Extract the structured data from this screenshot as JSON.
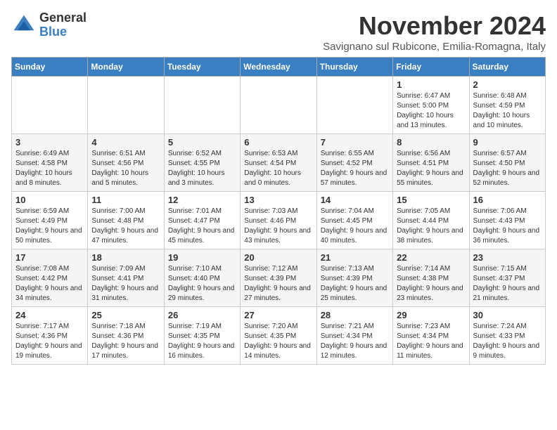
{
  "logo": {
    "general": "General",
    "blue": "Blue"
  },
  "header": {
    "month": "November 2024",
    "location": "Savignano sul Rubicone, Emilia-Romagna, Italy"
  },
  "weekdays": [
    "Sunday",
    "Monday",
    "Tuesday",
    "Wednesday",
    "Thursday",
    "Friday",
    "Saturday"
  ],
  "weeks": [
    [
      {
        "day": "",
        "sunrise": "",
        "sunset": "",
        "daylight": ""
      },
      {
        "day": "",
        "sunrise": "",
        "sunset": "",
        "daylight": ""
      },
      {
        "day": "",
        "sunrise": "",
        "sunset": "",
        "daylight": ""
      },
      {
        "day": "",
        "sunrise": "",
        "sunset": "",
        "daylight": ""
      },
      {
        "day": "",
        "sunrise": "",
        "sunset": "",
        "daylight": ""
      },
      {
        "day": "1",
        "sunrise": "Sunrise: 6:47 AM",
        "sunset": "Sunset: 5:00 PM",
        "daylight": "Daylight: 10 hours and 13 minutes."
      },
      {
        "day": "2",
        "sunrise": "Sunrise: 6:48 AM",
        "sunset": "Sunset: 4:59 PM",
        "daylight": "Daylight: 10 hours and 10 minutes."
      }
    ],
    [
      {
        "day": "3",
        "sunrise": "Sunrise: 6:49 AM",
        "sunset": "Sunset: 4:58 PM",
        "daylight": "Daylight: 10 hours and 8 minutes."
      },
      {
        "day": "4",
        "sunrise": "Sunrise: 6:51 AM",
        "sunset": "Sunset: 4:56 PM",
        "daylight": "Daylight: 10 hours and 5 minutes."
      },
      {
        "day": "5",
        "sunrise": "Sunrise: 6:52 AM",
        "sunset": "Sunset: 4:55 PM",
        "daylight": "Daylight: 10 hours and 3 minutes."
      },
      {
        "day": "6",
        "sunrise": "Sunrise: 6:53 AM",
        "sunset": "Sunset: 4:54 PM",
        "daylight": "Daylight: 10 hours and 0 minutes."
      },
      {
        "day": "7",
        "sunrise": "Sunrise: 6:55 AM",
        "sunset": "Sunset: 4:52 PM",
        "daylight": "Daylight: 9 hours and 57 minutes."
      },
      {
        "day": "8",
        "sunrise": "Sunrise: 6:56 AM",
        "sunset": "Sunset: 4:51 PM",
        "daylight": "Daylight: 9 hours and 55 minutes."
      },
      {
        "day": "9",
        "sunrise": "Sunrise: 6:57 AM",
        "sunset": "Sunset: 4:50 PM",
        "daylight": "Daylight: 9 hours and 52 minutes."
      }
    ],
    [
      {
        "day": "10",
        "sunrise": "Sunrise: 6:59 AM",
        "sunset": "Sunset: 4:49 PM",
        "daylight": "Daylight: 9 hours and 50 minutes."
      },
      {
        "day": "11",
        "sunrise": "Sunrise: 7:00 AM",
        "sunset": "Sunset: 4:48 PM",
        "daylight": "Daylight: 9 hours and 47 minutes."
      },
      {
        "day": "12",
        "sunrise": "Sunrise: 7:01 AM",
        "sunset": "Sunset: 4:47 PM",
        "daylight": "Daylight: 9 hours and 45 minutes."
      },
      {
        "day": "13",
        "sunrise": "Sunrise: 7:03 AM",
        "sunset": "Sunset: 4:46 PM",
        "daylight": "Daylight: 9 hours and 43 minutes."
      },
      {
        "day": "14",
        "sunrise": "Sunrise: 7:04 AM",
        "sunset": "Sunset: 4:45 PM",
        "daylight": "Daylight: 9 hours and 40 minutes."
      },
      {
        "day": "15",
        "sunrise": "Sunrise: 7:05 AM",
        "sunset": "Sunset: 4:44 PM",
        "daylight": "Daylight: 9 hours and 38 minutes."
      },
      {
        "day": "16",
        "sunrise": "Sunrise: 7:06 AM",
        "sunset": "Sunset: 4:43 PM",
        "daylight": "Daylight: 9 hours and 36 minutes."
      }
    ],
    [
      {
        "day": "17",
        "sunrise": "Sunrise: 7:08 AM",
        "sunset": "Sunset: 4:42 PM",
        "daylight": "Daylight: 9 hours and 34 minutes."
      },
      {
        "day": "18",
        "sunrise": "Sunrise: 7:09 AM",
        "sunset": "Sunset: 4:41 PM",
        "daylight": "Daylight: 9 hours and 31 minutes."
      },
      {
        "day": "19",
        "sunrise": "Sunrise: 7:10 AM",
        "sunset": "Sunset: 4:40 PM",
        "daylight": "Daylight: 9 hours and 29 minutes."
      },
      {
        "day": "20",
        "sunrise": "Sunrise: 7:12 AM",
        "sunset": "Sunset: 4:39 PM",
        "daylight": "Daylight: 9 hours and 27 minutes."
      },
      {
        "day": "21",
        "sunrise": "Sunrise: 7:13 AM",
        "sunset": "Sunset: 4:39 PM",
        "daylight": "Daylight: 9 hours and 25 minutes."
      },
      {
        "day": "22",
        "sunrise": "Sunrise: 7:14 AM",
        "sunset": "Sunset: 4:38 PM",
        "daylight": "Daylight: 9 hours and 23 minutes."
      },
      {
        "day": "23",
        "sunrise": "Sunrise: 7:15 AM",
        "sunset": "Sunset: 4:37 PM",
        "daylight": "Daylight: 9 hours and 21 minutes."
      }
    ],
    [
      {
        "day": "24",
        "sunrise": "Sunrise: 7:17 AM",
        "sunset": "Sunset: 4:36 PM",
        "daylight": "Daylight: 9 hours and 19 minutes."
      },
      {
        "day": "25",
        "sunrise": "Sunrise: 7:18 AM",
        "sunset": "Sunset: 4:36 PM",
        "daylight": "Daylight: 9 hours and 17 minutes."
      },
      {
        "day": "26",
        "sunrise": "Sunrise: 7:19 AM",
        "sunset": "Sunset: 4:35 PM",
        "daylight": "Daylight: 9 hours and 16 minutes."
      },
      {
        "day": "27",
        "sunrise": "Sunrise: 7:20 AM",
        "sunset": "Sunset: 4:35 PM",
        "daylight": "Daylight: 9 hours and 14 minutes."
      },
      {
        "day": "28",
        "sunrise": "Sunrise: 7:21 AM",
        "sunset": "Sunset: 4:34 PM",
        "daylight": "Daylight: 9 hours and 12 minutes."
      },
      {
        "day": "29",
        "sunrise": "Sunrise: 7:23 AM",
        "sunset": "Sunset: 4:34 PM",
        "daylight": "Daylight: 9 hours and 11 minutes."
      },
      {
        "day": "30",
        "sunrise": "Sunrise: 7:24 AM",
        "sunset": "Sunset: 4:33 PM",
        "daylight": "Daylight: 9 hours and 9 minutes."
      }
    ]
  ]
}
